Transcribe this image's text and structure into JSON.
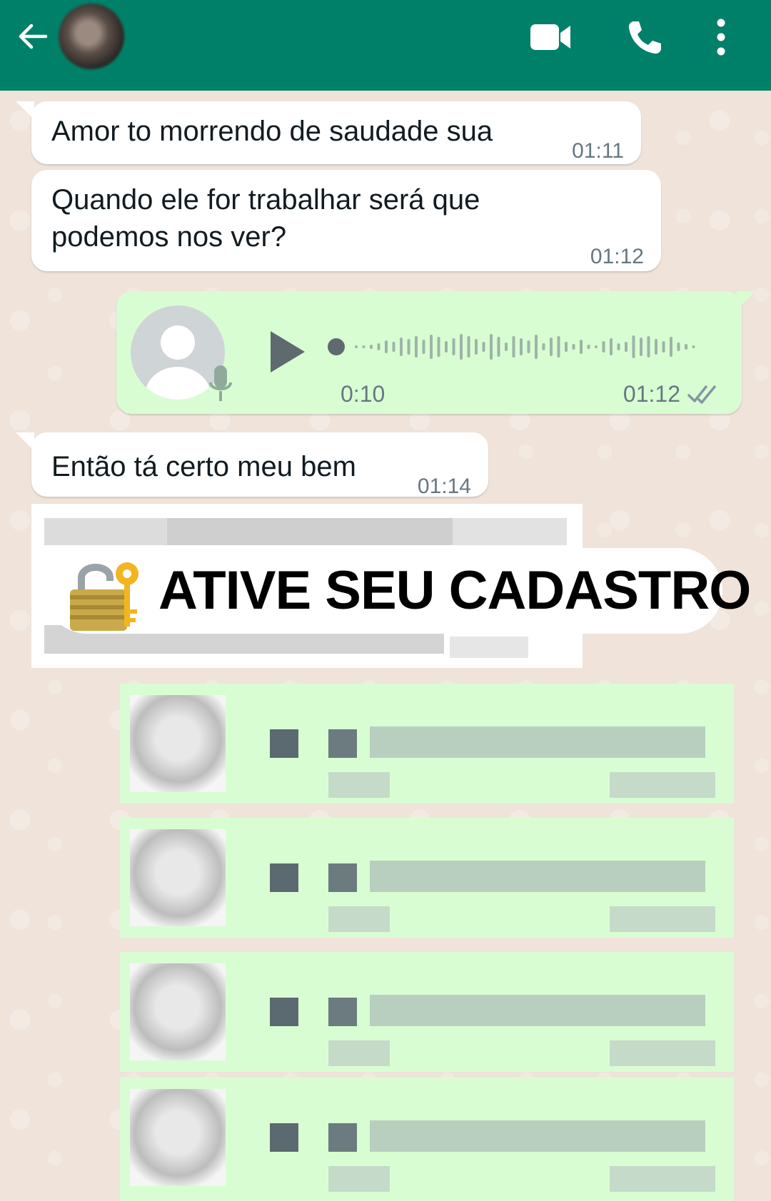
{
  "header": {
    "background": "#008069",
    "icons": [
      "back-arrow-icon",
      "contact-avatar",
      "video-call-icon",
      "voice-call-icon",
      "more-options-icon"
    ]
  },
  "messages": [
    {
      "direction": "incoming",
      "text": "Amor to morrendo de saudade sua",
      "time": "01:11"
    },
    {
      "direction": "incoming",
      "text": "Quando ele for trabalhar será que podemos nos ver?",
      "time": "01:12"
    },
    {
      "direction": "outgoing",
      "type": "voice",
      "duration": "0:10",
      "time": "01:12",
      "status_icon": "double-check-icon"
    },
    {
      "direction": "incoming",
      "text": "Então tá certo meu bem",
      "time": "01:14"
    }
  ],
  "banner": {
    "text": "ATIVE SEU CADASTRO",
    "icon": "lock-with-key-icon"
  },
  "colors": {
    "incoming_bubble": "#ffffff",
    "outgoing_bubble": "#d9fdd3",
    "time": "#667781",
    "accent": "#008069"
  }
}
